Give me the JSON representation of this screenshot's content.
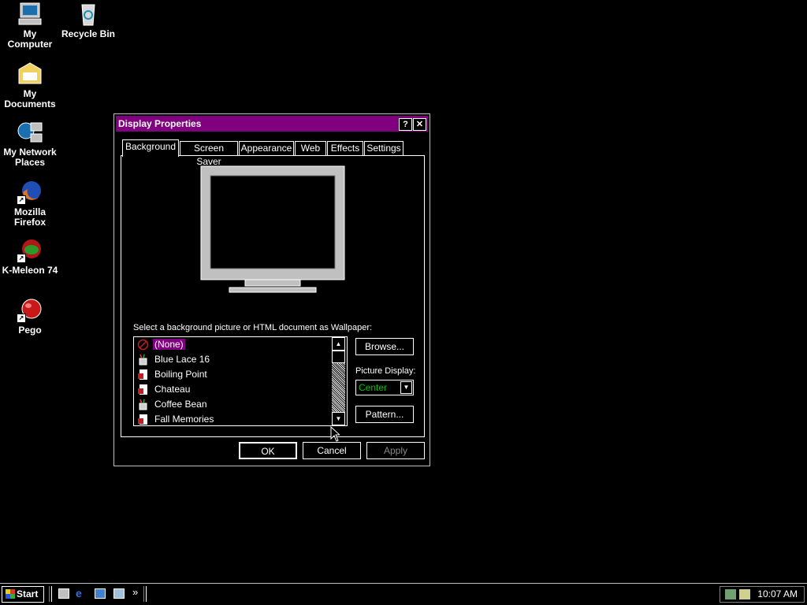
{
  "desktop": {
    "icons": [
      {
        "label_line1": "My",
        "label_line2": "Computer"
      },
      {
        "label_line1": "Recycle Bin",
        "label_line2": ""
      },
      {
        "label_line1": "My",
        "label_line2": "Documents"
      },
      {
        "label_line1": "My Network",
        "label_line2": "Places"
      },
      {
        "label_line1": "Mozilla",
        "label_line2": "Firefox"
      },
      {
        "label_line1": "K-Meleon 74",
        "label_line2": ""
      },
      {
        "label_line1": "Pego",
        "label_line2": ""
      }
    ]
  },
  "dialog": {
    "title": "Display Properties",
    "help_glyph": "?",
    "close_glyph": "✕",
    "tabs": [
      "Background",
      "Screen Saver",
      "Appearance",
      "Web",
      "Effects",
      "Settings"
    ],
    "active_tab": "Background",
    "wallpaper_prompt": "Select a background picture or HTML document as Wallpaper:",
    "wallpapers": [
      "(None)",
      "Blue Lace 16",
      "Boiling Point",
      "Chateau",
      "Coffee Bean",
      "Fall Memories"
    ],
    "selected_wallpaper": "(None)",
    "browse_label": "Browse...",
    "picture_display_label": "Picture Display:",
    "picture_display_value": "Center",
    "pattern_label": "Pattern...",
    "ok_label": "OK",
    "cancel_label": "Cancel",
    "apply_label": "Apply"
  },
  "taskbar": {
    "start_label": "Start",
    "chevron": "»",
    "clock": "10:07 AM"
  },
  "colors": {
    "desktop": "#000000",
    "titlebar": "#800080",
    "selection": "#800080",
    "dropdown_text": "#00c000"
  }
}
